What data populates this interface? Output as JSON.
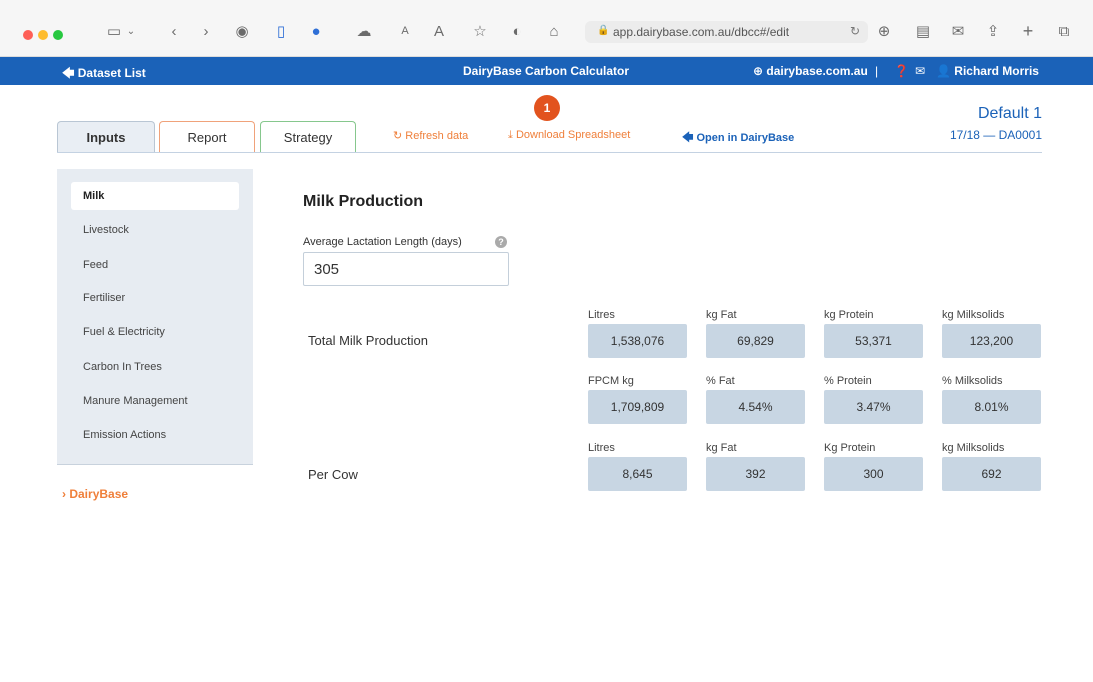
{
  "browser": {
    "url": "app.dairybase.com.au/dbcc#/edit",
    "colors": {
      "close": "#fe5f57",
      "minimize": "#febc2e",
      "zoom": "#28c840"
    }
  },
  "header": {
    "back_label": "Dataset List",
    "app_title": "DairyBase Carbon Calculator",
    "site_link": "dairybase.com.au",
    "separator": "|",
    "user_name": "Richard Morris"
  },
  "tabs": [
    {
      "label": "Inputs"
    },
    {
      "label": "Report"
    },
    {
      "label": "Strategy"
    }
  ],
  "actions": {
    "refresh": "Refresh data",
    "download": "Download Spreadsheet",
    "open_dairybase": "Open in DairyBase",
    "badge_count": "1"
  },
  "dataset": {
    "name": "Default 1",
    "period": "17/18 — DA0001"
  },
  "sidebar": {
    "items": [
      {
        "label": "Milk"
      },
      {
        "label": "Livestock"
      },
      {
        "label": "Feed"
      },
      {
        "label": "Fertiliser"
      },
      {
        "label": "Fuel & Electricity"
      },
      {
        "label": "Carbon In Trees"
      },
      {
        "label": "Manure Management"
      },
      {
        "label": "Emission Actions"
      }
    ],
    "footer_link": "DairyBase"
  },
  "main": {
    "title": "Milk Production",
    "lactation_label": "Average Lactation Length (days)",
    "lactation_value": "305",
    "total_label": "Total Milk Production",
    "per_cow_label": "Per Cow",
    "total_headers_1": [
      "Litres",
      "kg Fat",
      "kg Protein",
      "kg Milksolids"
    ],
    "total_values_1": [
      "1,538,076",
      "69,829",
      "53,371",
      "123,200"
    ],
    "total_headers_2": [
      "FPCM kg",
      "% Fat",
      "% Protein",
      "% Milksolids"
    ],
    "total_values_2": [
      "1,709,809",
      "4.54%",
      "3.47%",
      "8.01%"
    ],
    "cow_headers": [
      "Litres",
      "kg Fat",
      "Kg Protein",
      "kg Milksolids"
    ],
    "cow_values": [
      "8,645",
      "392",
      "300",
      "692"
    ]
  }
}
